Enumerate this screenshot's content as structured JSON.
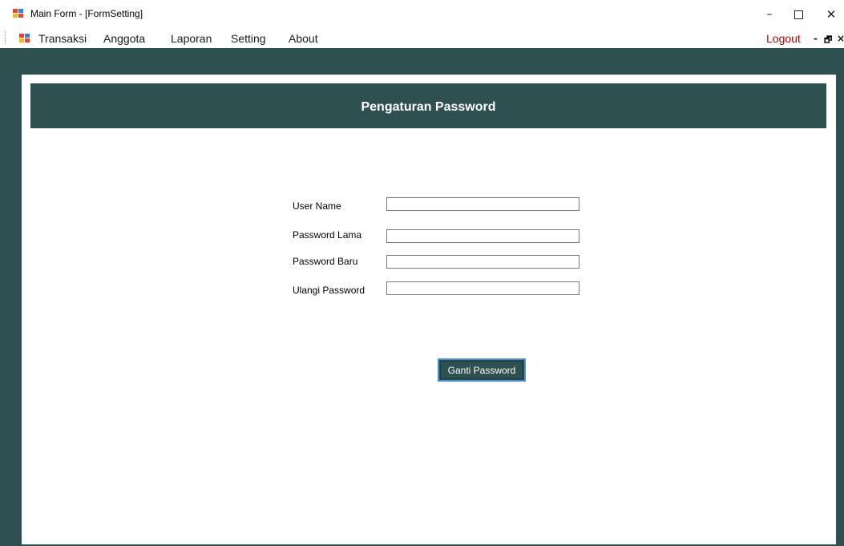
{
  "window": {
    "title": "Main Form - [FormSetting]",
    "minimize_glyph": "–",
    "close_glyph": "✕"
  },
  "menu": {
    "items": [
      "Transaksi",
      "Anggota",
      "Laporan",
      "Setting",
      "About"
    ],
    "logout": "Logout",
    "mdi_minimize": "-",
    "mdi_restore": "🗗",
    "mdi_close": "×"
  },
  "form": {
    "header": "Pengaturan Password",
    "fields": [
      {
        "label": "User Name",
        "value": ""
      },
      {
        "label": "Password Lama",
        "value": ""
      },
      {
        "label": "Password Baru",
        "value": ""
      },
      {
        "label": "Ulangi Password",
        "value": ""
      }
    ],
    "submit_label": "Ganti Password"
  },
  "colors": {
    "accent": "#2e5050",
    "logout": "#c00000",
    "button_focus": "#4a8fd6"
  }
}
